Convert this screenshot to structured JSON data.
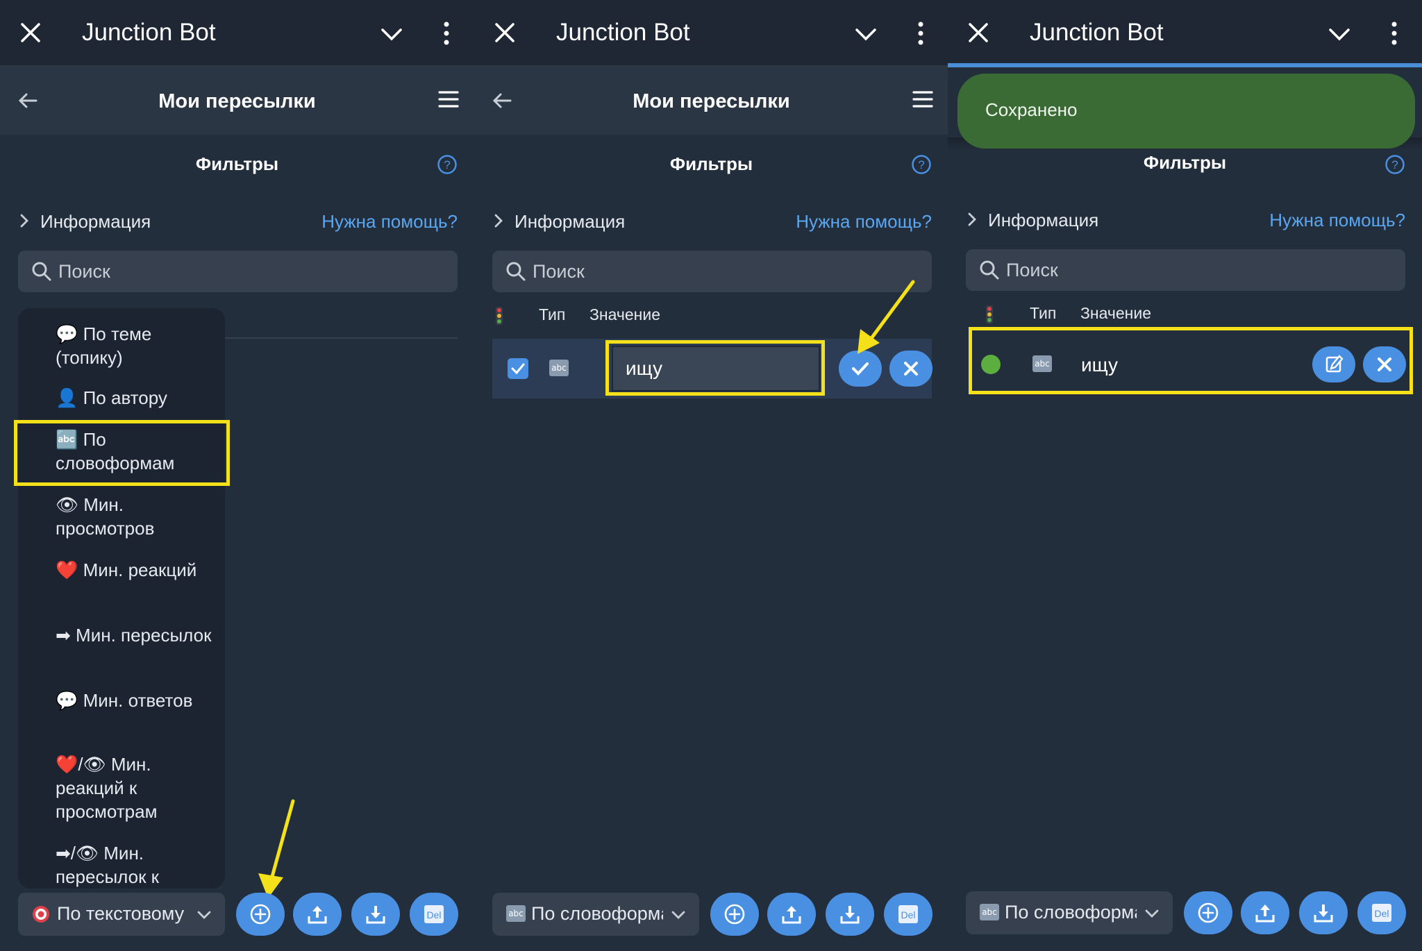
{
  "colors": {
    "bg": "#232e3c",
    "header_bg": "#1e2733",
    "accent": "#4a90e2",
    "link": "#5aa6f0",
    "toast_bg": "#3a6b34",
    "highlight": "#f5e11a"
  },
  "header": {
    "title": "Junction Bot",
    "close_icon": "close-icon",
    "dropdown_icon": "chevron-down-icon",
    "more_icon": "kebab-icon"
  },
  "nav": {
    "title": "Мои пересылки"
  },
  "filters": {
    "title": "Фильтры"
  },
  "info": {
    "label": "Информация",
    "help": "Нужна помощь?"
  },
  "search": {
    "placeholder": "Поиск"
  },
  "table": {
    "col_type": "Тип",
    "col_value": "Значение"
  },
  "dropdown": {
    "items": [
      {
        "emoji": "💬",
        "label": "По теме (топику)"
      },
      {
        "emoji": "👤",
        "label": "По автору"
      },
      {
        "emoji": "🔤",
        "label": "По словоформам"
      },
      {
        "emoji": "👁",
        "label": "Мин. просмотров"
      },
      {
        "emoji": "❤️",
        "label": "Мин. реакций"
      },
      {
        "emoji": "➡",
        "label": "Мин. пересылок"
      },
      {
        "emoji": "💬",
        "label": "Мин. ответов"
      },
      {
        "emoji": "❤️/👁",
        "label": "Мин. реакций к просмотрам"
      },
      {
        "emoji": "➡/👁",
        "label": "Мин. пересылок к"
      }
    ]
  },
  "panel1": {
    "select_label": "По текстовому"
  },
  "panel2": {
    "input_value": "ищу",
    "select_label": "По словоформам"
  },
  "panel3": {
    "toast": "Сохранено",
    "row_value": "ищу",
    "select_label": "По словоформам"
  },
  "abc_text": "abc",
  "del_text": "Del"
}
